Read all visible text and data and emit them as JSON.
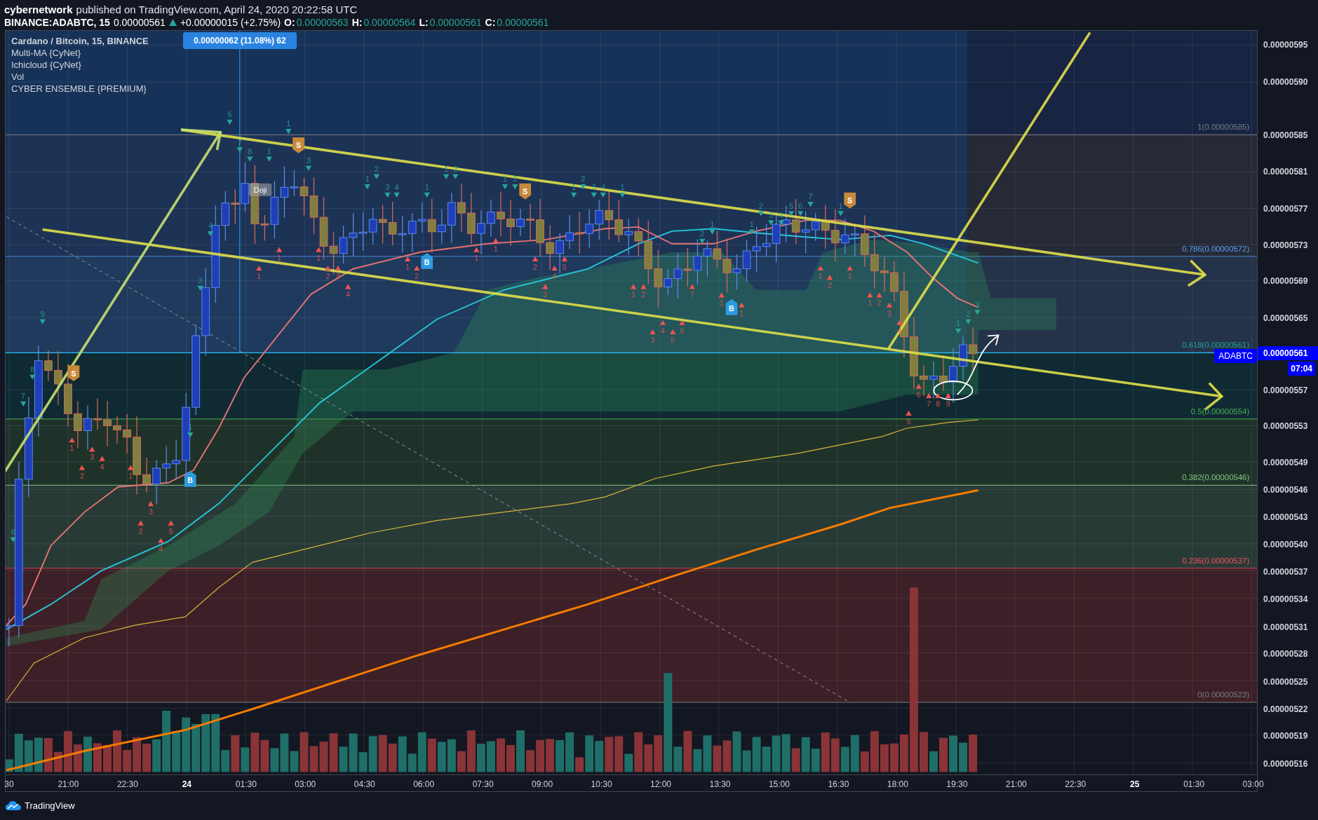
{
  "header": {
    "author": "cybernetwork",
    "published": "published on TradingView.com, April 24, 2020 20:22:58 UTC"
  },
  "quote": {
    "symbol": "BINANCE:ADABTC, 15",
    "price": "0.00000561",
    "change": "+0.00000015 (+2.75%)",
    "ohlc": [
      {
        "label": "O:",
        "value": "0.00000563"
      },
      {
        "label": "H:",
        "value": "0.00000564"
      },
      {
        "label": "L:",
        "value": "0.00000561"
      },
      {
        "label": "C:",
        "value": "0.00000561"
      }
    ]
  },
  "legend": [
    "Cardano / Bitcoin, 15, BINANCE",
    "Multi-MA {CyNet}",
    "Ichicloud {CyNet}",
    "Vol",
    "CYBER ENSEMBLE {PREMIUM}"
  ],
  "measure": "0.00000062 (11.08%) 62",
  "fib_levels": [
    {
      "label": "1(0.00000585)",
      "color": "#787b86"
    },
    {
      "label": "0.786(0.00000572)",
      "color": "#5b9cf6"
    },
    {
      "label": "0.618(0.00000561)",
      "color": "#26a69a"
    },
    {
      "label": "0.5(0.00000554)",
      "color": "#4caf50"
    },
    {
      "label": "0.382(0.00000546)",
      "color": "#81c784"
    },
    {
      "label": "0.236(0.00000537)",
      "color": "#f7525f"
    },
    {
      "label": "0(0.00000523)",
      "color": "#787b86"
    }
  ],
  "markers": [
    {
      "text": "S",
      "kind": "sell"
    },
    {
      "text": "S",
      "kind": "sell"
    },
    {
      "text": "S",
      "kind": "sell"
    },
    {
      "text": "S",
      "kind": "sell"
    },
    {
      "text": "B",
      "kind": "buy"
    },
    {
      "text": "B",
      "kind": "buy"
    },
    {
      "text": "B",
      "kind": "buy"
    }
  ],
  "doji": "Doji",
  "td_counts": [
    {
      "text": "6",
      "kind": "green"
    },
    {
      "text": "7",
      "kind": "green"
    },
    {
      "text": "8",
      "kind": "green"
    },
    {
      "text": "9",
      "kind": "green"
    },
    {
      "text": "1",
      "kind": "green"
    },
    {
      "text": "3",
      "kind": "green"
    },
    {
      "text": "4",
      "kind": "green"
    },
    {
      "text": "6",
      "kind": "green"
    },
    {
      "text": "7",
      "kind": "green"
    },
    {
      "text": "8",
      "kind": "green"
    },
    {
      "text": "1",
      "kind": "green"
    },
    {
      "text": "1",
      "kind": "green"
    },
    {
      "text": "3",
      "kind": "green"
    },
    {
      "text": "1",
      "kind": "green"
    },
    {
      "text": "2",
      "kind": "green"
    },
    {
      "text": "3",
      "kind": "green"
    },
    {
      "text": "4",
      "kind": "green"
    },
    {
      "text": "1",
      "kind": "green"
    },
    {
      "text": "1",
      "kind": "green"
    },
    {
      "text": "2",
      "kind": "green"
    },
    {
      "text": "1",
      "kind": "green"
    },
    {
      "text": "2",
      "kind": "green"
    },
    {
      "text": "1",
      "kind": "green"
    },
    {
      "text": "2",
      "kind": "green"
    },
    {
      "text": "3",
      "kind": "green"
    },
    {
      "text": "4",
      "kind": "green"
    },
    {
      "text": "1",
      "kind": "green"
    },
    {
      "text": "2",
      "kind": "green"
    },
    {
      "text": "1",
      "kind": "green"
    },
    {
      "text": "1",
      "kind": "green"
    },
    {
      "text": "2",
      "kind": "green"
    },
    {
      "text": "3",
      "kind": "green"
    },
    {
      "text": "4",
      "kind": "green"
    },
    {
      "text": "5",
      "kind": "green"
    },
    {
      "text": "6",
      "kind": "green"
    },
    {
      "text": "7",
      "kind": "green"
    },
    {
      "text": "1",
      "kind": "green"
    },
    {
      "text": "1",
      "kind": "green"
    },
    {
      "text": "2",
      "kind": "green"
    },
    {
      "text": "3",
      "kind": "green"
    },
    {
      "text": "1",
      "kind": "red"
    },
    {
      "text": "2",
      "kind": "red"
    },
    {
      "text": "3",
      "kind": "red"
    },
    {
      "text": "4",
      "kind": "red"
    },
    {
      "text": "1",
      "kind": "red"
    },
    {
      "text": "2",
      "kind": "red"
    },
    {
      "text": "3",
      "kind": "red"
    },
    {
      "text": "4",
      "kind": "red"
    },
    {
      "text": "5",
      "kind": "red"
    },
    {
      "text": "1",
      "kind": "red"
    },
    {
      "text": "1",
      "kind": "red"
    },
    {
      "text": "1",
      "kind": "red"
    },
    {
      "text": "2",
      "kind": "red"
    },
    {
      "text": "3",
      "kind": "red"
    },
    {
      "text": "4",
      "kind": "red"
    },
    {
      "text": "1",
      "kind": "red"
    },
    {
      "text": "2",
      "kind": "red"
    },
    {
      "text": "1",
      "kind": "red"
    },
    {
      "text": "1",
      "kind": "red"
    },
    {
      "text": "2",
      "kind": "red"
    },
    {
      "text": "3",
      "kind": "red"
    },
    {
      "text": "4",
      "kind": "red"
    },
    {
      "text": "5",
      "kind": "red"
    },
    {
      "text": "1",
      "kind": "red"
    },
    {
      "text": "2",
      "kind": "red"
    },
    {
      "text": "3",
      "kind": "red"
    },
    {
      "text": "4",
      "kind": "red"
    },
    {
      "text": "5",
      "kind": "red"
    },
    {
      "text": "6",
      "kind": "red"
    },
    {
      "text": "7",
      "kind": "red"
    },
    {
      "text": "1",
      "kind": "red"
    },
    {
      "text": "1",
      "kind": "red"
    },
    {
      "text": "1",
      "kind": "red"
    },
    {
      "text": "2",
      "kind": "red"
    },
    {
      "text": "1",
      "kind": "red"
    },
    {
      "text": "1",
      "kind": "red"
    },
    {
      "text": "2",
      "kind": "red"
    },
    {
      "text": "3",
      "kind": "red"
    },
    {
      "text": "4",
      "kind": "red"
    },
    {
      "text": "5",
      "kind": "red"
    },
    {
      "text": "6",
      "kind": "red"
    },
    {
      "text": "7",
      "kind": "red"
    },
    {
      "text": "8",
      "kind": "red"
    },
    {
      "text": "9",
      "kind": "red"
    }
  ],
  "price_axis": [
    "0.00000595",
    "0.00000590",
    "0.00000585",
    "0.00000581",
    "0.00000577",
    "0.00000573",
    "0.00000569",
    "0.00000565",
    "0.00000557",
    "0.00000553",
    "0.00000549",
    "0.00000546",
    "0.00000543",
    "0.00000540",
    "0.00000537",
    "0.00000534",
    "0.00000531",
    "0.00000528",
    "0.00000525",
    "0.00000522",
    "0.00000519",
    "0.00000516"
  ],
  "price_tag": {
    "symbol": "ADABTC",
    "price": "0.00000561",
    "countdown": "07:04"
  },
  "time_axis": [
    {
      "label": "30",
      "bold": false
    },
    {
      "label": "21:00",
      "bold": false
    },
    {
      "label": "22:30",
      "bold": false
    },
    {
      "label": "24",
      "bold": true
    },
    {
      "label": "01:30",
      "bold": false
    },
    {
      "label": "03:00",
      "bold": false
    },
    {
      "label": "04:30",
      "bold": false
    },
    {
      "label": "06:00",
      "bold": false
    },
    {
      "label": "07:30",
      "bold": false
    },
    {
      "label": "09:00",
      "bold": false
    },
    {
      "label": "10:30",
      "bold": false
    },
    {
      "label": "12:00",
      "bold": false
    },
    {
      "label": "13:30",
      "bold": false
    },
    {
      "label": "15:00",
      "bold": false
    },
    {
      "label": "16:30",
      "bold": false
    },
    {
      "label": "18:00",
      "bold": false
    },
    {
      "label": "19:30",
      "bold": false
    },
    {
      "label": "21:00",
      "bold": false
    },
    {
      "label": "22:30",
      "bold": false
    },
    {
      "label": "25",
      "bold": true
    },
    {
      "label": "01:30",
      "bold": false
    },
    {
      "label": "03:00",
      "bold": false
    }
  ],
  "footer": {
    "brand": "TradingView"
  }
}
